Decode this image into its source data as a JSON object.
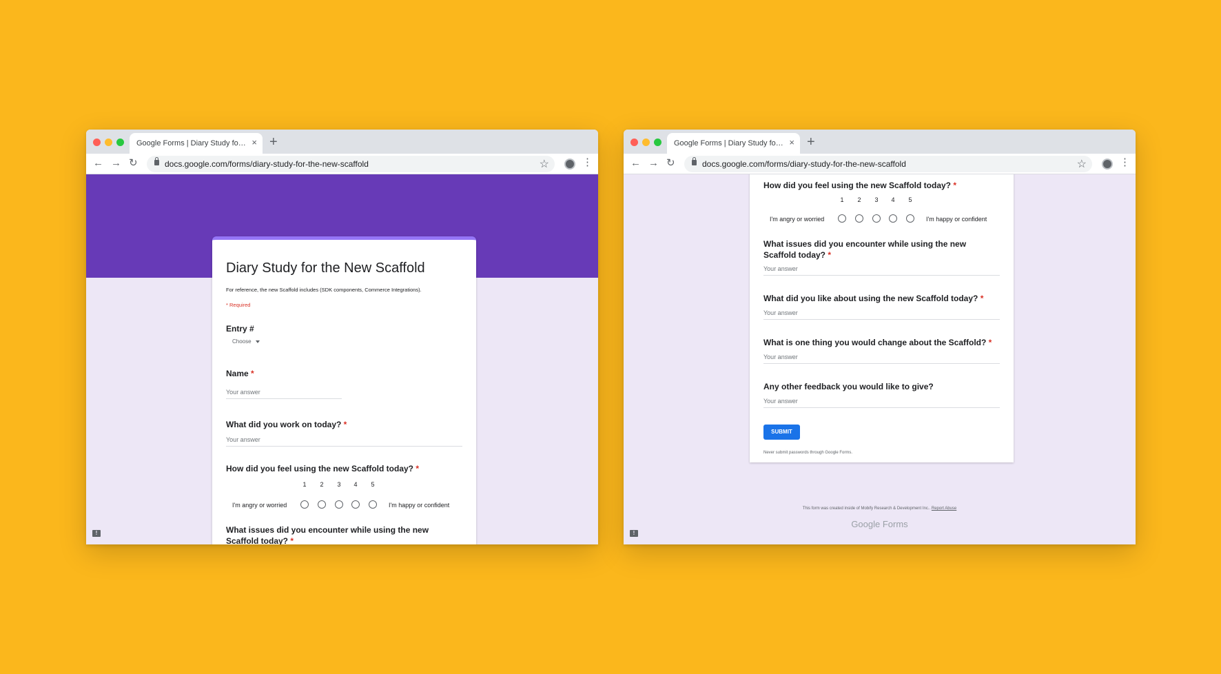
{
  "browser": {
    "tab_title": "Google Forms | Diary Study for the New Scaffold",
    "tab_close": "×",
    "new_tab": "+",
    "url": "docs.google.com/forms/diary-study-for-the-new-scaffold",
    "back": "←",
    "forward": "→",
    "reload": "↻",
    "star": "☆",
    "menu": "⋮"
  },
  "form": {
    "title": "Diary Study for the New Scaffold",
    "description": "For reference, the new Scaffold includes (SDK components, Commerce Integrations).",
    "required_note": "* Required",
    "entry_label": "Entry #",
    "entry_choose": "Choose",
    "name_label": "Name",
    "answer_placeholder": "Your answer",
    "q_work": "What did you work on today?",
    "q_feel": "How did you feel using the new Scaffold today?",
    "q_issues": "What issues did you encounter while using the new Scaffold today?",
    "q_like": "What did you like about using the new Scaffold today?",
    "q_change": "What is one thing you would change about the Scaffold?",
    "q_other": "Any other feedback you would like to give?",
    "required_mark": "*",
    "scale": [
      "1",
      "2",
      "3",
      "4",
      "5"
    ],
    "scale_low": "I'm angry or worried",
    "scale_high": "I'm happy or confident",
    "submit": "SUBMIT",
    "password_note": "Never submit passwords through Google Forms.",
    "footer_text": "This form was created inside of Mobify Research & Development Inc..",
    "report_abuse": "Report Abuse",
    "brand": "Google Forms",
    "feedback_icon": "!"
  },
  "colors": {
    "background": "#FBB71C",
    "banner": "#673AB7",
    "page": "#EDE7F6",
    "accent_bar": "#9575F7",
    "submit": "#1A73E8",
    "required": "#D93025"
  },
  "icons": [
    "back-icon",
    "forward-icon",
    "reload-icon",
    "lock-icon",
    "star-icon",
    "profile-icon",
    "menu-icon",
    "feedback-icon",
    "close-icon",
    "plus-icon"
  ]
}
